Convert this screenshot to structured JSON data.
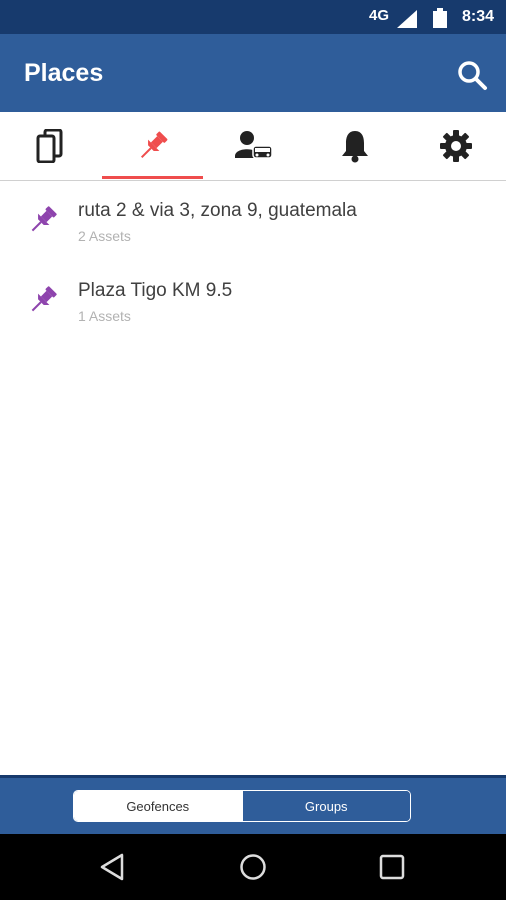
{
  "status_bar": {
    "network": "4G",
    "time": "8:34"
  },
  "app_bar": {
    "title": "Places"
  },
  "tabs": [
    {
      "icon": "devices-icon"
    },
    {
      "icon": "pin-icon",
      "selected": true
    },
    {
      "icon": "driver-vehicle-icon"
    },
    {
      "icon": "bell-icon"
    },
    {
      "icon": "gear-icon"
    }
  ],
  "places": [
    {
      "name": "ruta 2 & via 3, zona 9,  guatemala",
      "assets": "2 Assets"
    },
    {
      "name": "Plaza Tigo KM 9.5",
      "assets": "1 Assets"
    }
  ],
  "segment": {
    "geofences": "Geofences",
    "groups": "Groups",
    "selected": "groups"
  },
  "colors": {
    "status_bar": "#173a6d",
    "app_bar": "#2f5d9a",
    "accent": "#ef4d4d",
    "pin": "#8e44ad"
  }
}
